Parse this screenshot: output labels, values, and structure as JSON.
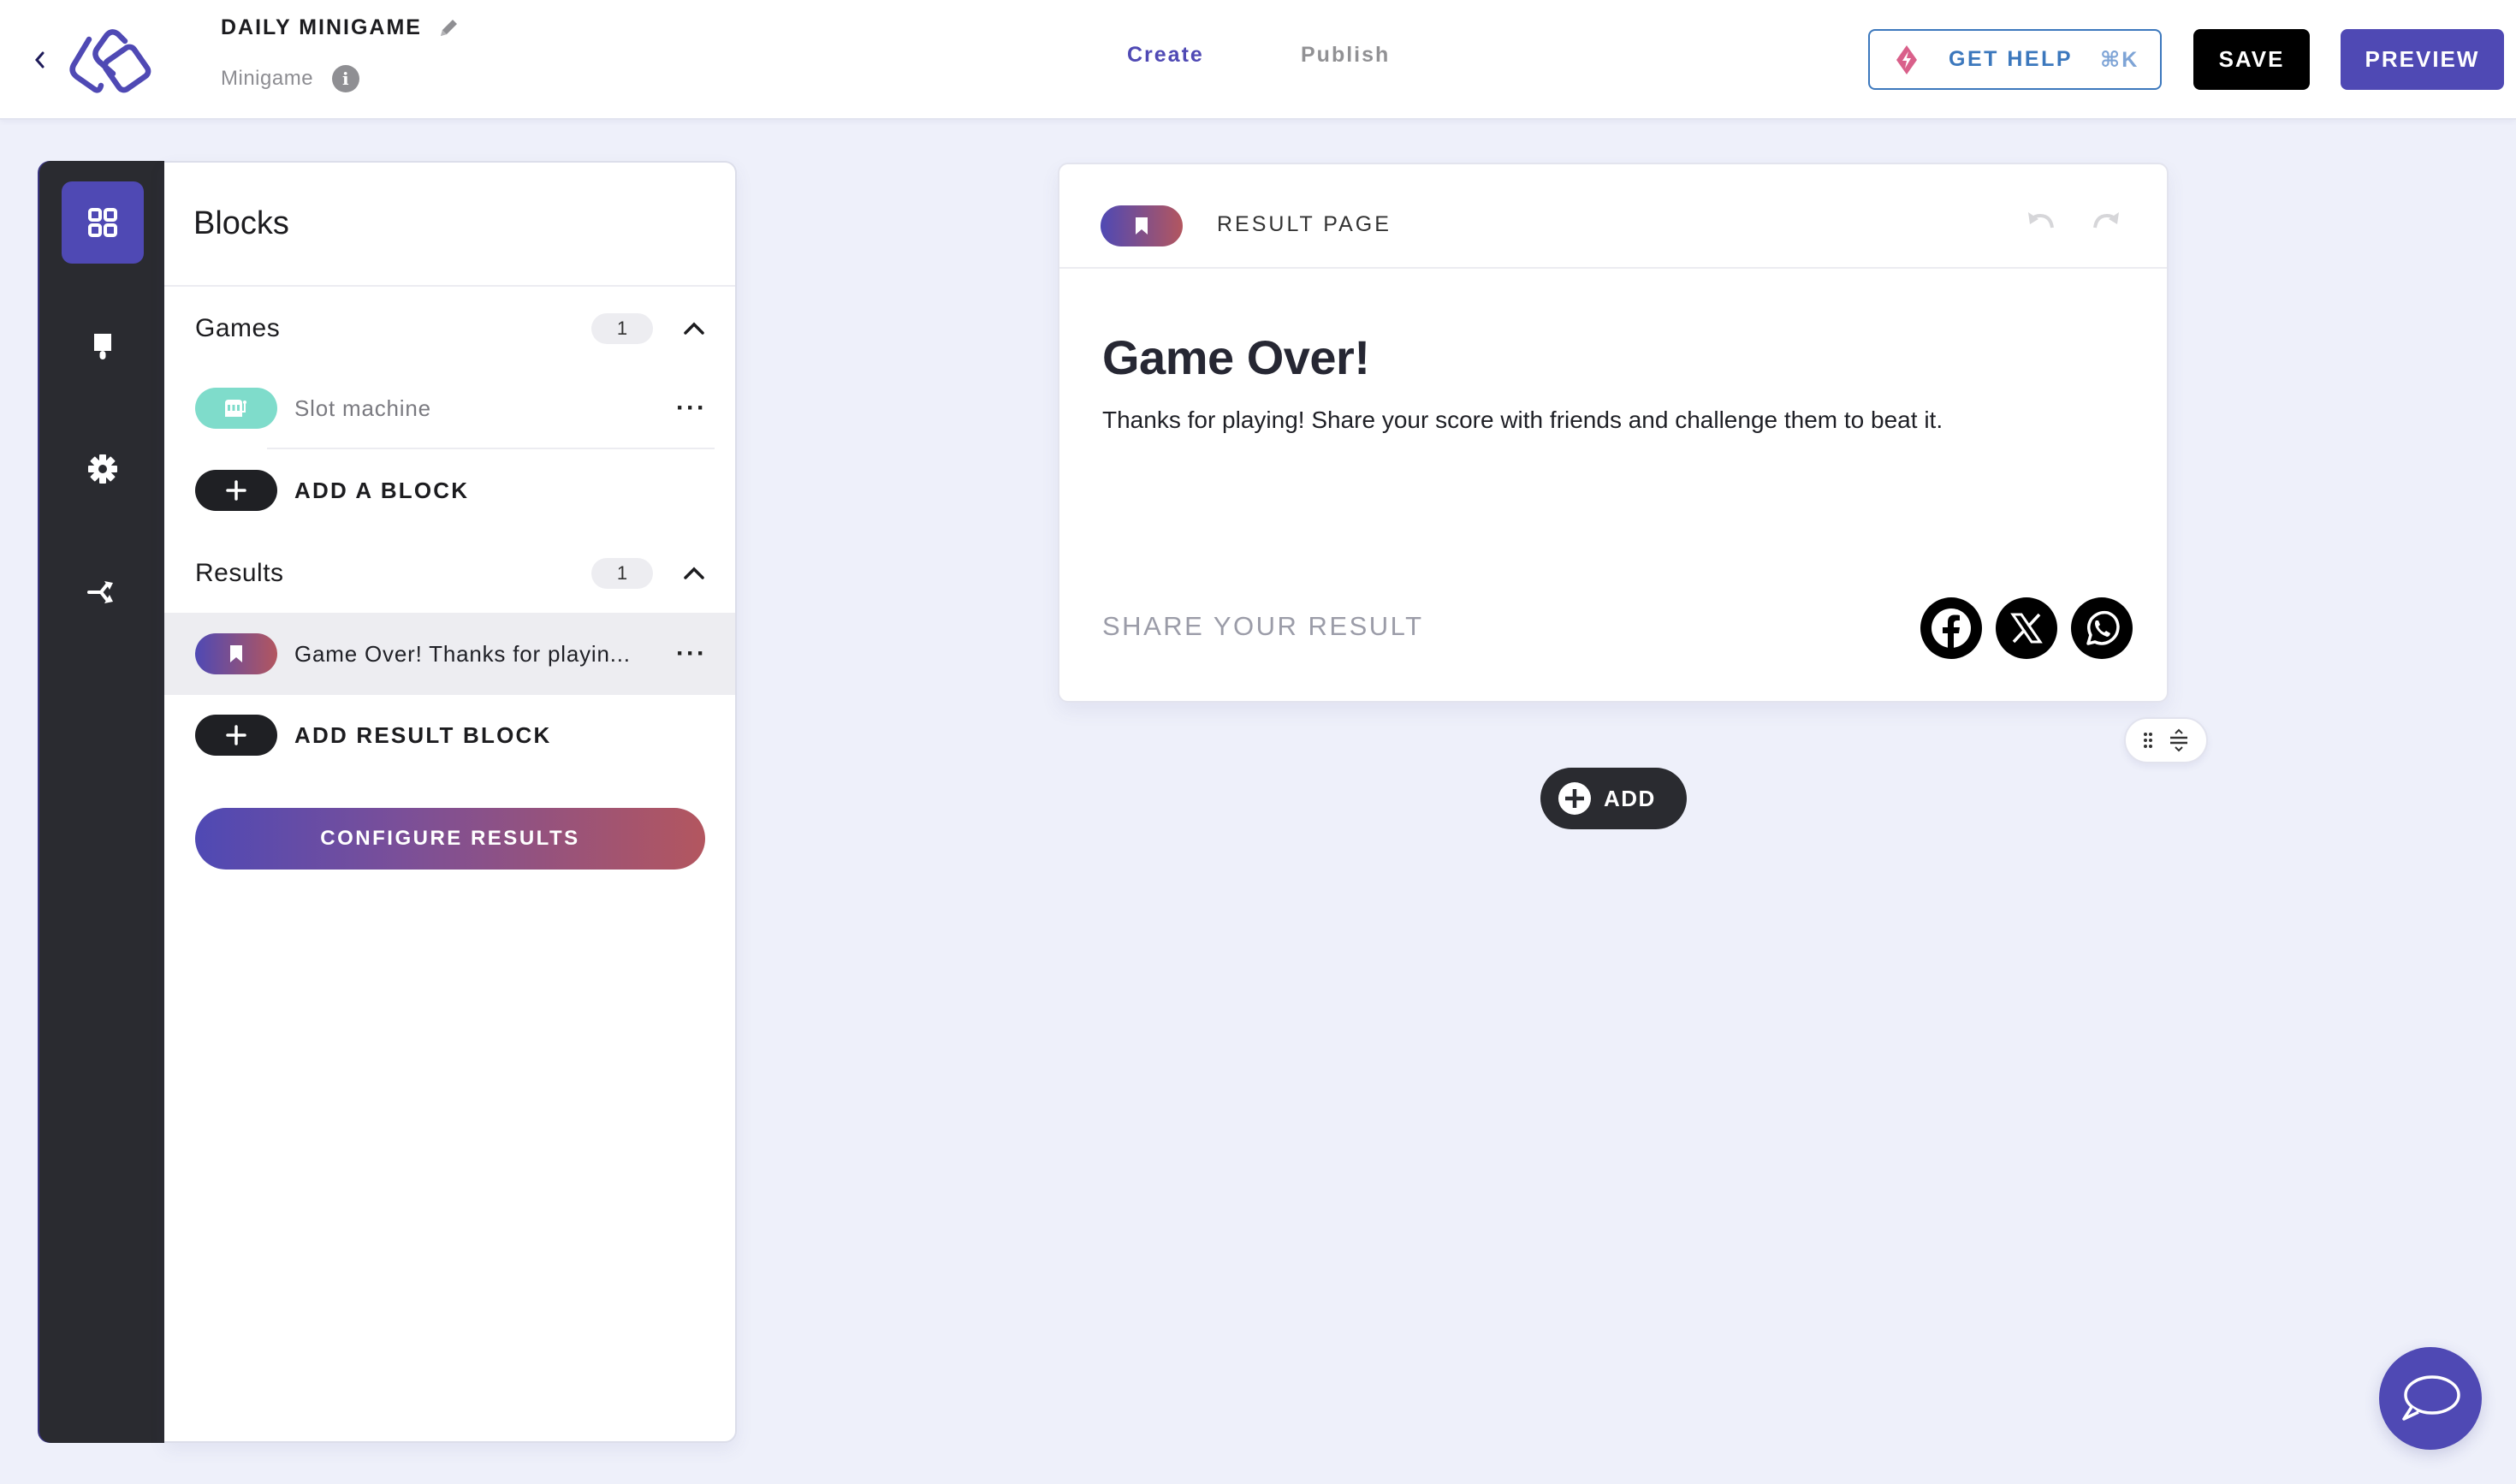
{
  "header": {
    "back_icon": "chevron-left-icon",
    "logo": "stacked-squares-logo",
    "title": "DAILY MINIGAME",
    "edit_icon": "pencil-icon",
    "subtitle": "Minigame",
    "info_icon": "info-icon",
    "tabs": [
      {
        "label": "Create",
        "active": true
      },
      {
        "label": "Publish",
        "active": false
      }
    ],
    "help_button": {
      "label": "GET HELP",
      "shortcut": "⌘K",
      "icon": "lightning-diamond-icon"
    },
    "save_label": "SAVE",
    "preview_label": "PREVIEW"
  },
  "colors": {
    "accent": "#4f49b4",
    "rail_bg": "#2a2b30",
    "gradient_start": "#4f49b4",
    "gradient_end": "#b3565f",
    "teal": "#7fdccb",
    "help_blue": "#3c78bd",
    "page_bg": "#eef0fa"
  },
  "rail": {
    "items": [
      {
        "name": "blocks",
        "icon": "grid-icon",
        "active": true
      },
      {
        "name": "design",
        "icon": "paint-brush-icon",
        "active": false
      },
      {
        "name": "settings",
        "icon": "gear-icon",
        "active": false
      },
      {
        "name": "connections",
        "icon": "branch-icon",
        "active": false
      }
    ]
  },
  "panel": {
    "title": "Blocks",
    "games": {
      "label": "Games",
      "count": "1",
      "items": [
        {
          "label": "Slot machine",
          "icon": "slot-machine-icon"
        }
      ],
      "add_label": "ADD A BLOCK"
    },
    "results": {
      "label": "Results",
      "count": "1",
      "items": [
        {
          "label": "Game Over! Thanks for playin...",
          "icon": "bookmark-icon"
        }
      ],
      "add_label": "ADD RESULT BLOCK"
    },
    "configure_label": "CONFIGURE RESULTS",
    "more_label": "···"
  },
  "card": {
    "label": "RESULT PAGE",
    "heading": "Game Over!",
    "body": "Thanks for playing! Share your score with friends and challenge them to beat it.",
    "share_label": "SHARE YOUR RESULT",
    "social": [
      "facebook",
      "x",
      "whatsapp"
    ]
  },
  "add_label": "ADD"
}
